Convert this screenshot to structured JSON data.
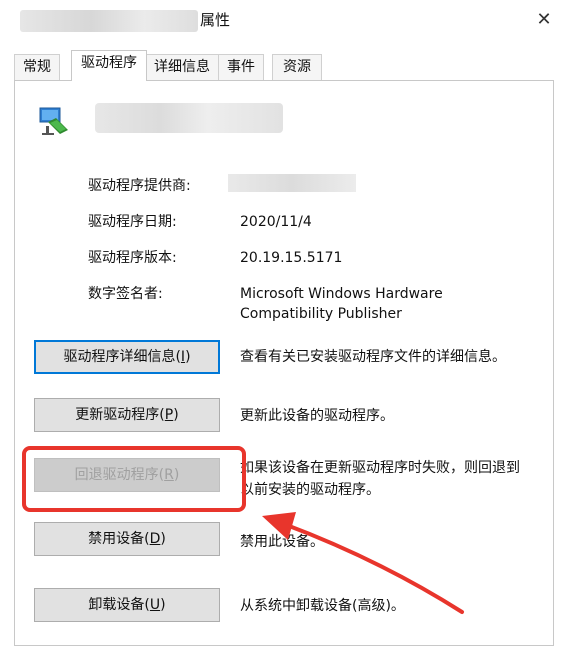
{
  "window": {
    "title_suffix": "属性",
    "close_glyph": "✕"
  },
  "tabs": [
    {
      "label": "常规"
    },
    {
      "label": "驱动程序"
    },
    {
      "label": "详细信息"
    },
    {
      "label": "事件"
    },
    {
      "label": "资源"
    }
  ],
  "active_tab": "驱动程序",
  "driver": {
    "provider_label": "驱动程序提供商:",
    "date_label": "驱动程序日期:",
    "date_value": "2020/11/4",
    "version_label": "驱动程序版本:",
    "version_value": "20.19.15.5171",
    "signer_label": "数字签名者:",
    "signer_line1": "Microsoft Windows Hardware",
    "signer_line2": "Compatibility Publisher"
  },
  "buttons": [
    {
      "label": "驱动程序详细信息(",
      "key": "I",
      "suffix": ")",
      "desc": "查看有关已安装驱动程序文件的详细信息。"
    },
    {
      "label": "更新驱动程序(",
      "key": "P",
      "suffix": ")",
      "desc": "更新此设备的驱动程序。"
    },
    {
      "label": "回退驱动程序(",
      "key": "R",
      "suffix": ")",
      "desc1": "如果该设备在更新驱动程序时失败，则回退到",
      "desc2": "以前安装的驱动程序。"
    },
    {
      "label": "禁用设备(",
      "key": "D",
      "suffix": ")",
      "desc": "禁用此设备。"
    },
    {
      "label": "卸载设备(",
      "key": "U",
      "suffix": ")",
      "desc": "从系统中卸载设备(高级)。"
    }
  ],
  "colors": {
    "annotation_red": "#e8352c",
    "focus_blue": "#0078d7"
  },
  "icons": {
    "device": "monitor-adapter-icon",
    "close": "close-icon"
  }
}
